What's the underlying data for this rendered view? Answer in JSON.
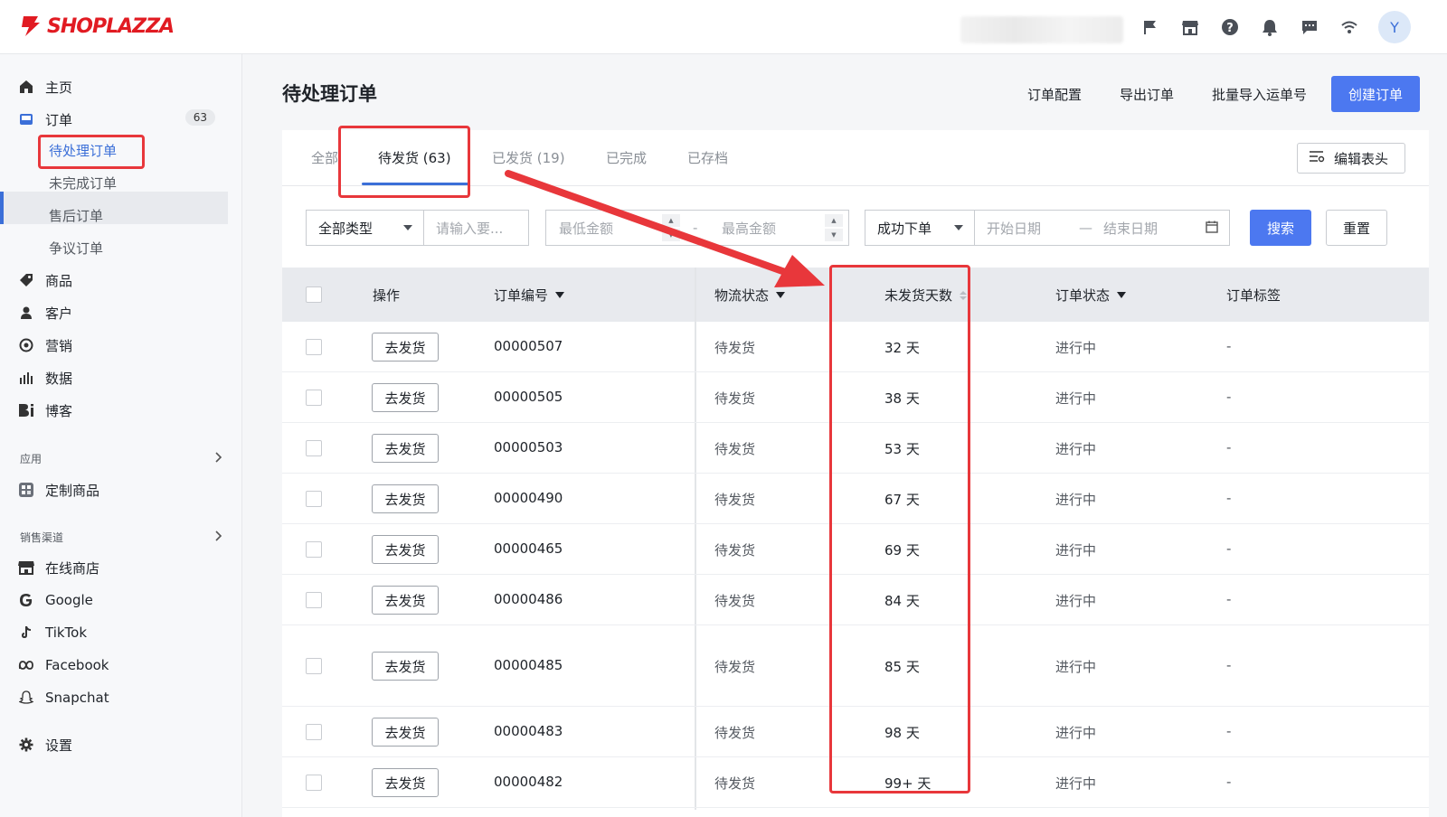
{
  "app": {
    "logo_text": "SHOPLAZZA",
    "avatar_initial": "Y"
  },
  "topbar": {
    "icons": [
      "flag-icon",
      "store-icon",
      "help-icon",
      "bell-icon",
      "chat-icon",
      "wifi-icon"
    ]
  },
  "sidebar": {
    "items": [
      {
        "label": "主页",
        "icon": "home-icon"
      },
      {
        "label": "订单",
        "icon": "inbox-icon",
        "badge": "63"
      },
      {
        "label": "商品",
        "icon": "tag-icon"
      },
      {
        "label": "客户",
        "icon": "person-icon"
      },
      {
        "label": "营销",
        "icon": "target-icon"
      },
      {
        "label": "数据",
        "icon": "bar-chart-icon"
      },
      {
        "label": "博客",
        "icon": "blog-icon"
      }
    ],
    "order_subitems": [
      "待处理订单",
      "未完成订单",
      "售后订单",
      "争议订单"
    ],
    "apps_label": "应用",
    "apps_items": [
      {
        "label": "定制商品",
        "icon": "custom-product-icon"
      }
    ],
    "channels_label": "销售渠道",
    "channels": [
      {
        "label": "在线商店",
        "icon": "store-icon"
      },
      {
        "label": "Google",
        "icon": "google-icon"
      },
      {
        "label": "TikTok",
        "icon": "tiktok-icon"
      },
      {
        "label": "Facebook",
        "icon": "meta-icon"
      },
      {
        "label": "Snapchat",
        "icon": "snapchat-icon"
      }
    ],
    "settings_label": "设置"
  },
  "page": {
    "title": "待处理订单",
    "actions": {
      "config": "订单配置",
      "export": "导出订单",
      "import": "批量导入运单号",
      "create": "创建订单"
    }
  },
  "tabs": [
    {
      "label": "全部"
    },
    {
      "label": "待发货 (63)"
    },
    {
      "label": "已发货 (19)"
    },
    {
      "label": "已完成"
    },
    {
      "label": "已存档"
    }
  ],
  "edit_header": "编辑表头",
  "filters": {
    "type_value": "全部类型",
    "keyword_placeholder": "请输入要...",
    "min_amount_placeholder": "最低金额",
    "amount_separator": "-",
    "max_amount_placeholder": "最高金额",
    "order_status_value": "成功下单",
    "start_date_placeholder": "开始日期",
    "date_separator": "—",
    "end_date_placeholder": "结束日期",
    "search": "搜索",
    "reset": "重置"
  },
  "table": {
    "headers": {
      "action": "操作",
      "order_no": "订单编号",
      "logistics": "物流状态",
      "unshipped_days": "未发货天数",
      "order_status": "订单状态",
      "order_tags": "订单标签"
    },
    "ship_label": "去发货",
    "rows": [
      {
        "order_no": "00000507",
        "logistics": "待发货",
        "days": "32 天",
        "status": "进行中",
        "tags": "-"
      },
      {
        "order_no": "00000505",
        "logistics": "待发货",
        "days": "38 天",
        "status": "进行中",
        "tags": "-"
      },
      {
        "order_no": "00000503",
        "logistics": "待发货",
        "days": "53 天",
        "status": "进行中",
        "tags": "-"
      },
      {
        "order_no": "00000490",
        "logistics": "待发货",
        "days": "67 天",
        "status": "进行中",
        "tags": "-"
      },
      {
        "order_no": "00000465",
        "logistics": "待发货",
        "days": "69 天",
        "status": "进行中",
        "tags": "-"
      },
      {
        "order_no": "00000486",
        "logistics": "待发货",
        "days": "84 天",
        "status": "进行中",
        "tags": "-"
      },
      {
        "order_no": "00000485",
        "logistics": "待发货",
        "days": "85 天",
        "status": "进行中",
        "tags": "-"
      },
      {
        "order_no": "00000483",
        "logistics": "待发货",
        "days": "98 天",
        "status": "进行中",
        "tags": "-"
      },
      {
        "order_no": "00000482",
        "logistics": "待发货",
        "days": "99+ 天",
        "status": "进行中",
        "tags": "-"
      }
    ]
  },
  "colors": {
    "accent": "#4c78f0",
    "annotation_red": "#e8373b",
    "brand_red": "#e11b22"
  }
}
